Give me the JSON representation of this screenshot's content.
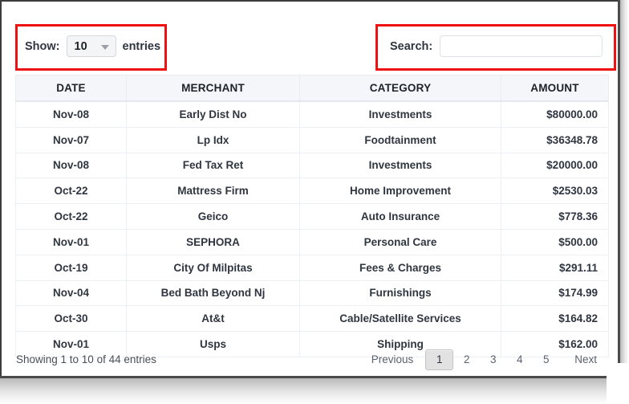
{
  "controls": {
    "length_label": "Show:",
    "length_value": "10",
    "length_suffix": "entries",
    "length_chevron_icon": "chevron-down-icon",
    "search_label": "Search:",
    "search_value": "",
    "search_placeholder": ""
  },
  "table": {
    "columns": [
      "DATE",
      "MERCHANT",
      "CATEGORY",
      "AMOUNT"
    ],
    "rows": [
      {
        "date": "Nov-08",
        "merchant": "Early Dist No",
        "category": "Investments",
        "amount": "$80000.00"
      },
      {
        "date": "Nov-07",
        "merchant": "Lp Idx",
        "category": "Foodtainment",
        "amount": "$36348.78"
      },
      {
        "date": "Nov-08",
        "merchant": "Fed Tax Ret",
        "category": "Investments",
        "amount": "$20000.00"
      },
      {
        "date": "Oct-22",
        "merchant": "Mattress Firm",
        "category": "Home Improvement",
        "amount": "$2530.03"
      },
      {
        "date": "Oct-22",
        "merchant": "Geico",
        "category": "Auto Insurance",
        "amount": "$778.36"
      },
      {
        "date": "Nov-01",
        "merchant": "SEPHORA",
        "category": "Personal Care",
        "amount": "$500.00"
      },
      {
        "date": "Oct-19",
        "merchant": "City Of Milpitas",
        "category": "Fees & Charges",
        "amount": "$291.11"
      },
      {
        "date": "Nov-04",
        "merchant": "Bed Bath Beyond Nj",
        "category": "Furnishings",
        "amount": "$174.99"
      },
      {
        "date": "Oct-30",
        "merchant": "At&t",
        "category": "Cable/Satellite Services",
        "amount": "$164.82"
      },
      {
        "date": "Nov-01",
        "merchant": "Usps",
        "category": "Shipping",
        "amount": "$162.00"
      }
    ]
  },
  "footer": {
    "info": "Showing 1 to 10 of 44 entries",
    "previous_label": "Previous",
    "next_label": "Next",
    "pages": [
      "1",
      "2",
      "3",
      "4",
      "5"
    ],
    "active_page": "1"
  },
  "annotations": {
    "color": "#ee1111",
    "boxes": [
      "length-control-highlight",
      "search-control-highlight"
    ]
  }
}
